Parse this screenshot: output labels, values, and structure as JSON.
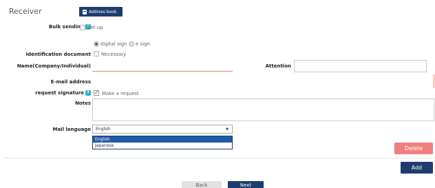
{
  "section": {
    "title": "Receiver",
    "address_book_label": "Address book"
  },
  "bulk_sending": {
    "label": "Bulk sending",
    "help": "?",
    "option_label": "Set up",
    "checked": false
  },
  "sign_type": {
    "options": [
      "digital sign",
      "e sign"
    ],
    "selected": "digital sign"
  },
  "identification": {
    "label": "Identification document",
    "option_label": "Necessary",
    "checked": false
  },
  "name": {
    "label": "Name(Company/Individual)",
    "value": ""
  },
  "attention": {
    "label": "Attention",
    "value": ""
  },
  "email": {
    "label": "E-mail address",
    "value": ""
  },
  "request_signature": {
    "label": "request signature",
    "help": "?",
    "option_label": "Make a request",
    "checked": true
  },
  "notes": {
    "label": "Notes",
    "value": ""
  },
  "mail_language": {
    "label": "Mail language",
    "selected": "English",
    "options": [
      "English",
      "Japanese"
    ],
    "highlighted": "English"
  },
  "actions": {
    "delete_label": "Delete",
    "add_label": "Add",
    "back_label": "Back",
    "next_label": "Next"
  },
  "colors": {
    "primary": "#1e3c6e",
    "danger": "#f08080",
    "help_badge": "#2ab3c8",
    "invalid_border": "#e8847c"
  }
}
